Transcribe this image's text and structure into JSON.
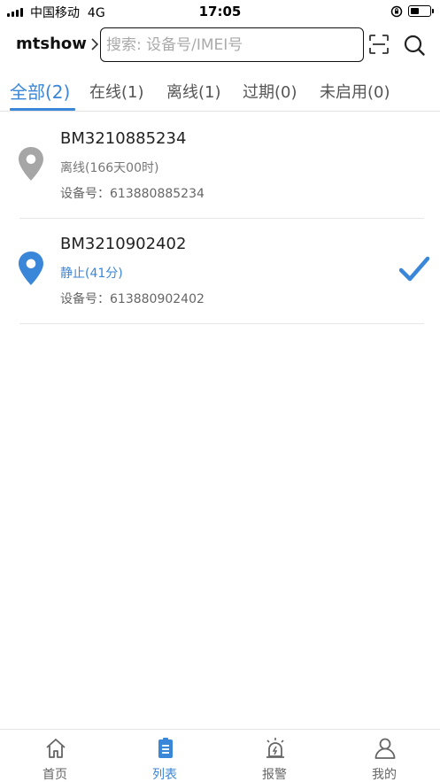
{
  "status_bar": {
    "carrier": "中国移动",
    "network": "4G",
    "time": "17:05",
    "battery_level": 0.45
  },
  "header": {
    "account": "mtshow",
    "search_placeholder": "搜索: 设备号/IMEI号",
    "scan_icon": "scan-icon",
    "search_icon": "search-icon"
  },
  "tabs": [
    {
      "label": "全部(2)",
      "active": true
    },
    {
      "label": "在线(1)",
      "active": false
    },
    {
      "label": "离线(1)",
      "active": false
    },
    {
      "label": "过期(0)",
      "active": false
    },
    {
      "label": "未启用(0)",
      "active": false
    }
  ],
  "devices": [
    {
      "name": "BM3210885234",
      "status": "离线(166天00时)",
      "imei": "设备号：613880885234",
      "pin_color": "#a6a6a6",
      "status_color": "#777777",
      "selected": false
    },
    {
      "name": "BM3210902402",
      "status": "静止(41分)",
      "imei": "设备号：613880902402",
      "pin_color": "#3a86d8",
      "status_color": "#3a86d8",
      "selected": true
    }
  ],
  "bottom_nav": [
    {
      "label": "首页",
      "icon": "home-icon",
      "active": false
    },
    {
      "label": "列表",
      "icon": "list-icon",
      "active": true
    },
    {
      "label": "报警",
      "icon": "alarm-icon",
      "active": false
    },
    {
      "label": "我的",
      "icon": "user-icon",
      "active": false
    }
  ],
  "colors": {
    "accent": "#3a86d8",
    "inactive": "#666666"
  }
}
